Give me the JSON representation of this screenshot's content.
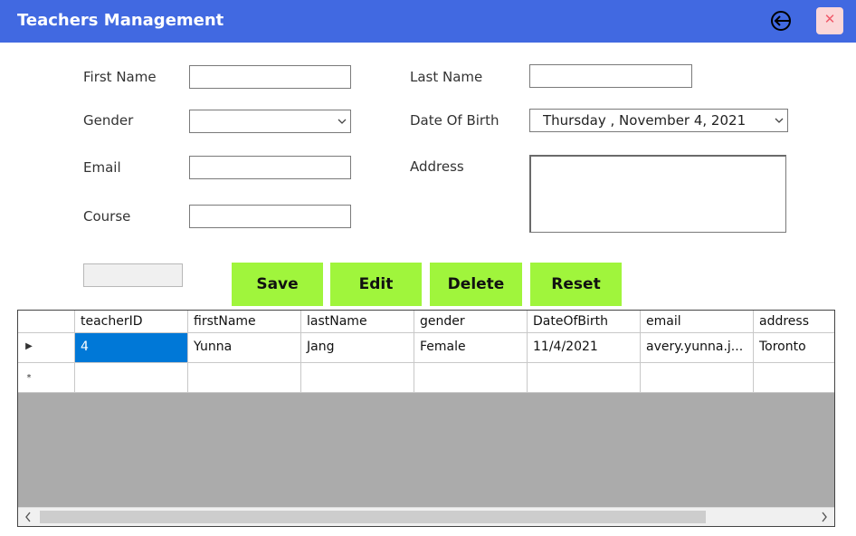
{
  "window": {
    "title": "Teachers Management"
  },
  "form": {
    "first_name_label": "First Name",
    "last_name_label": "Last Name",
    "gender_label": "Gender",
    "dob_label": "Date Of Birth",
    "dob_value": "Thursday  ,  November   4, 2021",
    "email_label": "Email",
    "address_label": "Address",
    "course_label": "Course"
  },
  "buttons": {
    "save": "Save",
    "edit": "Edit",
    "delete": "Delete",
    "reset": "Reset"
  },
  "grid": {
    "columns": [
      "teacherID",
      "firstName",
      "lastName",
      "gender",
      "DateOfBirth",
      "email",
      "address"
    ],
    "rows": [
      [
        "4",
        "Yunna",
        "Jang",
        "Female",
        "11/4/2021",
        "avery.yunna.j...",
        "Toronto"
      ]
    ],
    "row_marker": "▶",
    "new_row_marker": "*"
  },
  "icons": {
    "back": "back-arrow-icon",
    "close": "close-icon",
    "chevron": "chevron-down-icon"
  },
  "colors": {
    "titlebar": "#4169e1",
    "button": "#a0f53c",
    "selection": "#0078d7",
    "grid_background": "#ababab"
  }
}
